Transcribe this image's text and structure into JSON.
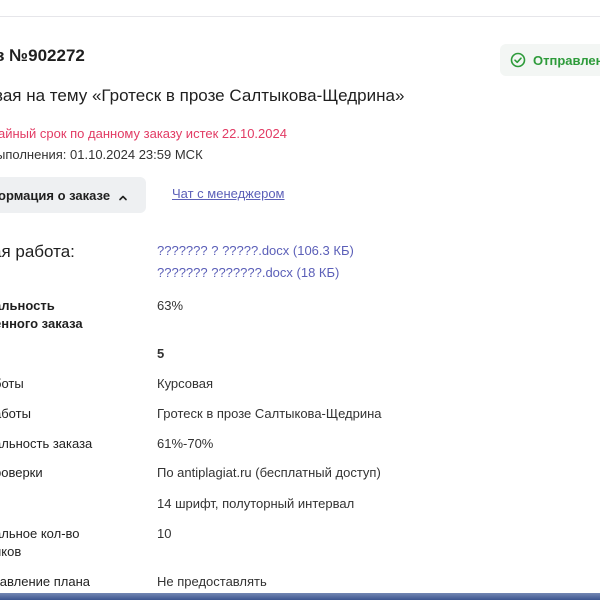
{
  "header": {
    "order_title": "з №902272",
    "status": {
      "label": "Отправлен",
      "color": "#2d9b3a",
      "icon": "check-circle-icon"
    }
  },
  "work_title": "вая на тему «Гротеск в прозе Салтыкова-Щедрина»",
  "warranty_notice": "айный срок по данному заказу истек 22.10.2024",
  "deadline_text": "ыполнения: 01.10.2024 23:59 МСК",
  "info_toggle": {
    "label": "ормация о заказе",
    "icon": "chevron-up-icon"
  },
  "chat_link": "Чат с менеджером",
  "ready_work": {
    "label": "ая работа:",
    "files": [
      "??????? ? ?????.docx (106.3 КБ)",
      "??????? ???????.docx (18 КБ)"
    ]
  },
  "details": [
    {
      "label_lines": [
        "альность",
        "енного заказа"
      ],
      "value": "63%",
      "label_bold": true,
      "value_bold": false
    },
    {
      "label_lines": [
        ""
      ],
      "value": "5",
      "label_bold": false,
      "value_bold": true
    },
    {
      "label_lines": [
        "боты"
      ],
      "value": "Курсовая",
      "label_bold": false,
      "value_bold": false
    },
    {
      "label_lines": [
        "аботы"
      ],
      "value": "Гротеск в прозе Салтыкова-Щедрина",
      "label_bold": false,
      "value_bold": false
    },
    {
      "label_lines": [
        "альность заказа"
      ],
      "value": "61%-70%",
      "label_bold": false,
      "value_bold": false
    },
    {
      "label_lines": [
        "роверки"
      ],
      "value": "По antiplagiat.ru (бесплатный доступ)",
      "label_bold": false,
      "value_bold": false
    },
    {
      "label_lines": [
        ""
      ],
      "value": "14 шрифт, полуторный интервал",
      "label_bold": false,
      "value_bold": false
    },
    {
      "label_lines": [
        "альное кол-во",
        "иков"
      ],
      "value": "10",
      "label_bold": false,
      "value_bold": false
    },
    {
      "label_lines": [
        "тавление плана"
      ],
      "value": "Не предоставлять",
      "label_bold": false,
      "value_bold": false
    }
  ]
}
